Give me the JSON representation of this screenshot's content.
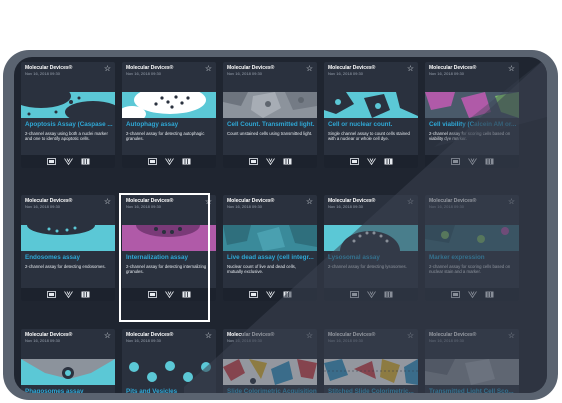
{
  "app": {
    "brand": "Molecular Devices®",
    "date": "Nov 16, 2018 09:30"
  },
  "tiles": [
    {
      "title": "Apoptosis Assay (Caspase ...",
      "desc": "2-channel assay using both a nuclei marker and one to identify apoptotic cells."
    },
    {
      "title": "Autophagy assay",
      "desc": "2-channel assay for detecting autophagic granules."
    },
    {
      "title": "Cell Count. Transmitted light.",
      "desc": "Count unstained cells using transmitted light."
    },
    {
      "title": "Cell or nuclear count.",
      "desc": "Single channel assay to count cells stained with a nuclear or whole cell dye."
    },
    {
      "title": "Cell viability (Calcein AM or...",
      "desc": "2-channel assay for scoring cells based on viability dye marker."
    },
    {
      "title": "Endosomes assay",
      "desc": "2-channel assay for detecting endosomes."
    },
    {
      "title": "Internalization assay",
      "desc": "2-channel assay for detecting internalizing granules."
    },
    {
      "title": "Live dead assay (cell integr...",
      "desc": "Nuclear count of live and dead cells, mutually exclusive."
    },
    {
      "title": "Lysosomal assay",
      "desc": "2-channel assay for detecting lysosomes."
    },
    {
      "title": "Marker expression",
      "desc": "2-channel assay for scoring cells based on nuclear stain and a marker."
    },
    {
      "title": "Phagosomes assay",
      "desc": ""
    },
    {
      "title": "Pits and Vesicles",
      "desc": ""
    },
    {
      "title": "Slide Colorimetric Acquisition",
      "desc": ""
    },
    {
      "title": "Stitched Slide Colorimetric...",
      "desc": ""
    },
    {
      "title": "Transmitted Light Cell Sco...",
      "desc": ""
    }
  ],
  "icons": {
    "star": "star-icon",
    "footer": [
      "image-icon",
      "measure-icon",
      "book-icon"
    ]
  },
  "colors": {
    "title_blue": "#2fa8d6",
    "cyan": "#5bc8d6",
    "magenta": "#b05aa8",
    "selected_border": "#ffffff"
  }
}
